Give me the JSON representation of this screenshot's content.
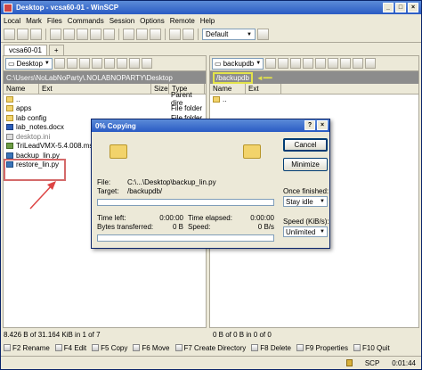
{
  "window": {
    "title": "Desktop - vcsa60-01 - WinSCP"
  },
  "menu": [
    "Local",
    "Mark",
    "Files",
    "Commands",
    "Session",
    "Options",
    "Remote",
    "Help"
  ],
  "toolbar": {
    "transfer_setting": "Default"
  },
  "tabs": [
    "vcsa60-01",
    "+"
  ],
  "left_pane": {
    "drive": "Desktop",
    "path": "C:\\Users\\NoLabNoParty\\.NOLABNOPARTY\\Desktop",
    "columns": [
      "Name",
      "Ext",
      "Size",
      "Type"
    ],
    "files": [
      {
        "name": "..",
        "type": "Parent dire",
        "icon": "up-icon"
      },
      {
        "name": "apps",
        "type": "File folder",
        "icon": "folder-icon"
      },
      {
        "name": "lab config",
        "type": "File folder",
        "icon": "folder-icon"
      },
      {
        "name": "lab_notes.docx",
        "type": "",
        "icon": "docx-icon"
      },
      {
        "name": "desktop.ini",
        "type": "",
        "icon": "ini-icon"
      },
      {
        "name": "TriLeadVMX-5.4.008.msi",
        "type": "",
        "icon": "msi-icon"
      },
      {
        "name": "backup_lin.py",
        "type": "",
        "icon": "python-icon"
      },
      {
        "name": "restore_lin.py",
        "type": "",
        "icon": "python-icon"
      }
    ],
    "status": "8.426 B of 31.164 KiB in 1 of 7"
  },
  "right_pane": {
    "drive": "backupdb",
    "path": "/backupdb",
    "columns": [
      "Name",
      "Ext"
    ],
    "files": [
      {
        "name": "..",
        "icon": "up-icon"
      }
    ],
    "status": "0 B of 0 B in 0 of 0"
  },
  "function_keys": [
    {
      "label": "F2 Rename"
    },
    {
      "label": "F4 Edit"
    },
    {
      "label": "F5 Copy"
    },
    {
      "label": "F6 Move"
    },
    {
      "label": "F7 Create Directory"
    },
    {
      "label": "F8 Delete"
    },
    {
      "label": "F9 Properties"
    },
    {
      "label": "F10 Quit"
    }
  ],
  "bottom_status": {
    "protocol": "SCP",
    "time": "0:01:44"
  },
  "dialog": {
    "title": "0% Copying",
    "file_label": "File:",
    "file_value": "C:\\...\\Desktop\\backup_lin.py",
    "target_label": "Target:",
    "target_value": "/backupdb/",
    "time_left_label": "Time left:",
    "time_left": "0:00:00",
    "time_elapsed_label": "Time elapsed:",
    "time_elapsed": "0:00:00",
    "bytes_label": "Bytes transferred:",
    "bytes_value": "0 B",
    "speed_label": "Speed:",
    "speed_value": "0 B/s",
    "file_progress": 0,
    "total_progress": 0,
    "cancel": "Cancel",
    "minimize": "Minimize",
    "once_finished_label": "Once finished:",
    "once_finished_value": "Stay idle",
    "speed_limit_label": "Speed (KiB/s):",
    "speed_limit_value": "Unlimited"
  }
}
